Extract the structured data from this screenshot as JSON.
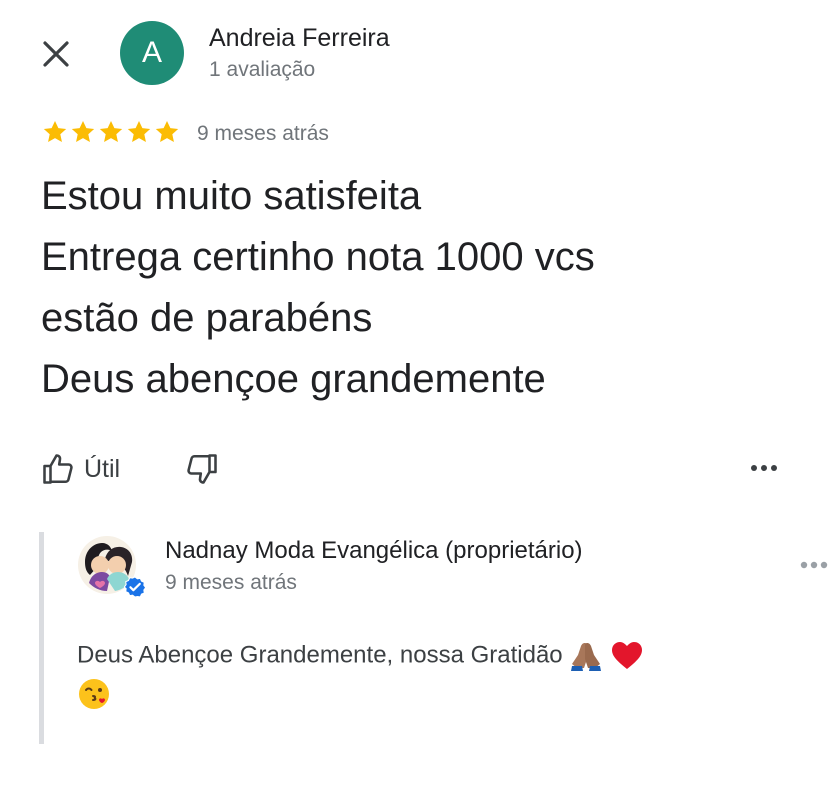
{
  "review": {
    "reviewer_name": "Andreia Ferreira",
    "reviewer_avatar_letter": "A",
    "reviewer_meta": "1 avaliação",
    "rating": 5,
    "rating_max": 5,
    "date": "9 meses atrás",
    "text_lines": [
      "Estou muito satisfeita",
      "Entrega certinho nota 1000 vcs",
      "estão de parabéns",
      "Deus abençoe grandemente"
    ]
  },
  "actions": {
    "helpful_label": "Útil"
  },
  "owner_reply": {
    "name": "Nadnay Moda Evangélica (proprietário)",
    "date": "9 meses atrás",
    "text": "Deus Abençoe Grandemente, nossa Gratidão",
    "emojis": [
      "folded-hands-emoji",
      "red-heart-emoji",
      "kissing-face-emoji"
    ]
  },
  "icons": {
    "close": "close-icon",
    "thumbs_up": "thumbs-up-icon",
    "thumbs_down": "thumbs-down-icon",
    "more": "more-horizontal-icon",
    "verified": "verified-badge-icon"
  },
  "colors": {
    "avatar_bg": "#1f8c76",
    "star": "#fbbc04",
    "secondary_text": "#70757a",
    "verified": "#1a73e8",
    "reply_rule": "#dadce0"
  }
}
